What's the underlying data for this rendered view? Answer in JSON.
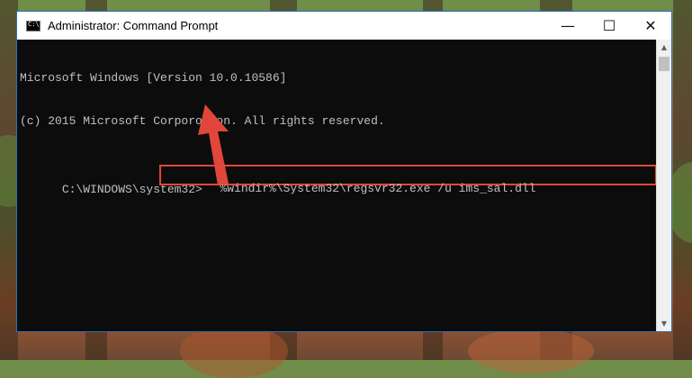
{
  "window": {
    "title": "Administrator: Command Prompt",
    "controls": {
      "minimize": "—",
      "maximize": "☐",
      "close": "✕"
    }
  },
  "console": {
    "lines": [
      "Microsoft Windows [Version 10.0.10586]",
      "(c) 2015 Microsoft Corporotion. All rights reserved."
    ],
    "prompt": "C:\\WINDOWS\\system32>",
    "command": "%windir%\\System32\\regsvr32.exe /u ims_sal.dll"
  },
  "scrollbar": {
    "up_glyph": "▲",
    "down_glyph": "▼"
  },
  "colors": {
    "highlight_box": "#e0473a",
    "arrow": "#e0473a",
    "console_bg": "#0c0c0c",
    "console_text": "#c0c0c0"
  }
}
